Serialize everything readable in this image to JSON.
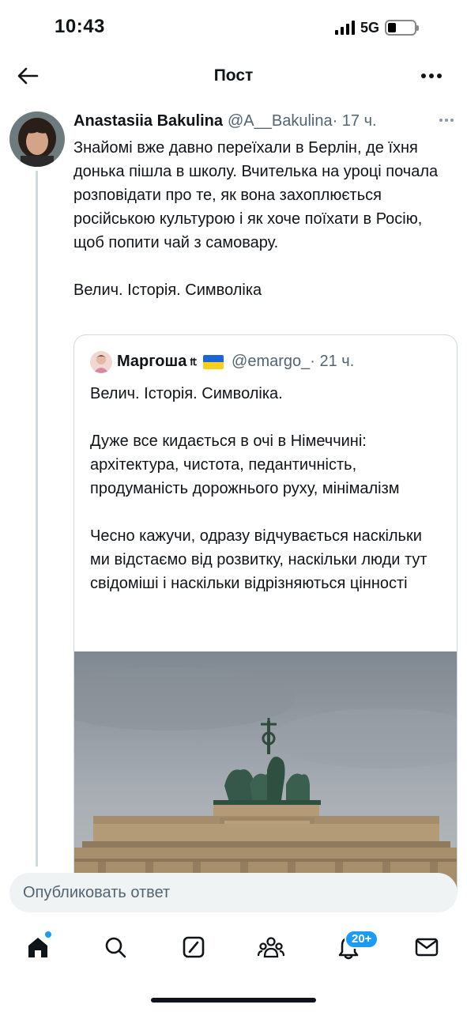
{
  "status_bar": {
    "time": "10:43",
    "network": "5G",
    "battery_level": 0.3
  },
  "header": {
    "title": "Пост",
    "back_icon": "arrow-left-icon",
    "more_icon": "more-horizontal-icon"
  },
  "post": {
    "author_name": "Anastasiia Bakulina",
    "author_handle": "@A__Bakulina",
    "time": "· 17 ч.",
    "text": "Знайомі вже давно переїхали в Берлін, де їхня донька пішла в школу. Вчителька на уроці почала розповідати про те, як вона захоплюється російською культурою і як хоче поїхати в Росію, щоб попити чай з самовару.\n\nВелич. Історія. Символіка"
  },
  "quote": {
    "author_name": "Маргоша",
    "trident": "₶",
    "flag": "ukraine-flag",
    "author_handle": "@emargo_",
    "time": "· 21 ч.",
    "text": "Велич. Історія. Символіка.\n\nДуже все кидається в очі в Німеччині: архітектура, чистота, педантичність, продуманість дорожнього руху, мінімалізм\n\nЧесно кажучи, одразу відчувається наскільки ми відстаємо від розвитку, наскільки люди тут свідоміші і наскільки відрізняються цінності",
    "image": "brandenburg-gate-photo"
  },
  "reply": {
    "placeholder": "Опубликовать ответ"
  },
  "bottom_nav": {
    "items": [
      "home-icon",
      "search-icon",
      "grok-icon",
      "communities-icon",
      "notifications-icon",
      "messages-icon"
    ],
    "notifications_badge": "20+",
    "accent_color": "#1d9bf0"
  }
}
